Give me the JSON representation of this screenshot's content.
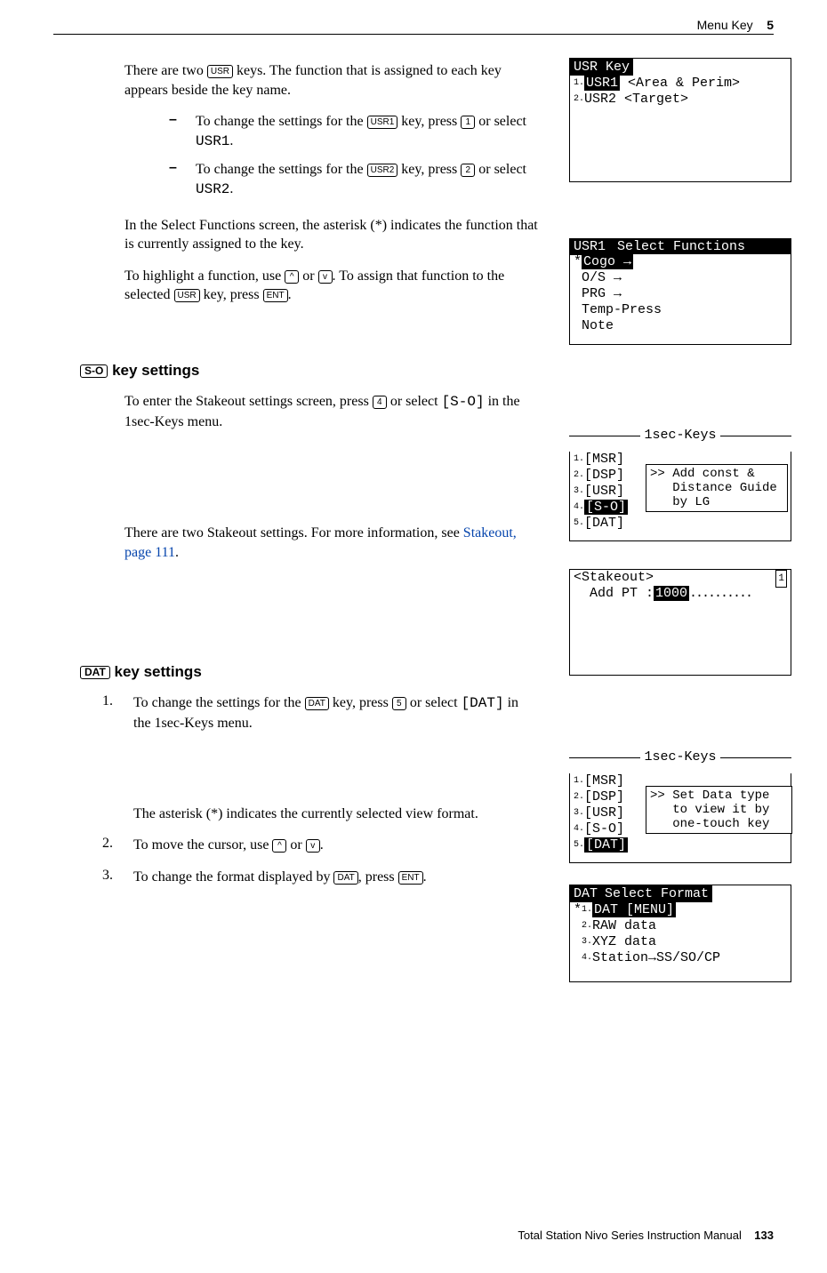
{
  "header": {
    "title": "Menu Key",
    "chapter": "5"
  },
  "footer": {
    "manual": "Total Station Nivo Series Instruction Manual",
    "page": "133"
  },
  "keys": {
    "usr": "USR",
    "usr1": "USR1",
    "usr2": "USR2",
    "ent": "ENT",
    "so": "S-O",
    "dat": "DAT",
    "k1": "1",
    "k2": "2",
    "k4": "4",
    "k5": "5",
    "up": "^",
    "down": "v"
  },
  "mono": {
    "usr1": "USR1",
    "usr2": "USR2",
    "so": "[S-O]",
    "dat": "[DAT]"
  },
  "body": {
    "p1a": "There are two ",
    "p1b": " keys. The function that is assigned to each key appears beside the key name.",
    "b1a": "To change the settings for the ",
    "b1b": " key, press ",
    "b1c": " or select ",
    "b1d": ".",
    "b2a": "To change the settings for the ",
    "b2b": " key, press ",
    "b2c": " or select ",
    "b2d": ".",
    "p2": "In the Select Functions screen, the asterisk (*) indicates the function that is currently assigned to the key.",
    "p3a": "To highlight a function, use ",
    "p3b": " or ",
    "p3c": ". To assign that function to the selected ",
    "p3d": " key, press ",
    "p3e": ".",
    "bullet_dash": "–"
  },
  "section_so": {
    "head": " key settings",
    "p1a": "To enter the Stakeout settings screen, press ",
    "p1b": " or select ",
    "p1c": " in the 1sec-Keys menu.",
    "p2a": "There are two Stakeout settings. For more information, see ",
    "link": "Stakeout, page 111",
    "p2b": "."
  },
  "section_dat": {
    "head": " key settings",
    "s1a": "To change the settings for the ",
    "s1b": " key, press ",
    "s1c": " or select ",
    "s1d": " in the 1sec-Keys menu.",
    "s_ast": "The asterisk (*) indicates the currently selected view format.",
    "s2a": "To move the cursor, use ",
    "s2b": " or ",
    "s2c": ".",
    "s3a": "To change the format displayed by ",
    "s3b": ", press ",
    "s3c": "."
  },
  "lcd1": {
    "title": "USR Key",
    "l1_inv": "USR1",
    "l1_rest": " <Area & Perim>",
    "l2": "USR2 <Target>"
  },
  "lcd2": {
    "title_a": "USR1",
    "title_b": " Select Functions",
    "l1": "Cogo →",
    "l2": "O/S →",
    "l3": "PRG →",
    "l4": "Temp-Press",
    "l5": "Note"
  },
  "lcd3": {
    "title": "1sec-Keys",
    "items": [
      "[MSR]",
      "[DSP]",
      "[USR]",
      "[S-O]",
      "[DAT]"
    ],
    "box": ">> Add const &\n   Distance Guide\n   by LG"
  },
  "lcd4": {
    "title": "<Stakeout>",
    "line": "Add PT :",
    "value": "1000"
  },
  "lcd5": {
    "title": "1sec-Keys",
    "items": [
      "[MSR]",
      "[DSP]",
      "[USR]",
      "[S-O]",
      "[DAT]"
    ],
    "box": ">> Set Data type\n   to view it by\n   one-touch key"
  },
  "lcd6": {
    "title_a": "DAT",
    "title_b": " Select Format",
    "l1": "DAT [MENU]",
    "l2": "RAW data",
    "l3": "XYZ data",
    "l4": "Station→SS/SO/CP"
  }
}
